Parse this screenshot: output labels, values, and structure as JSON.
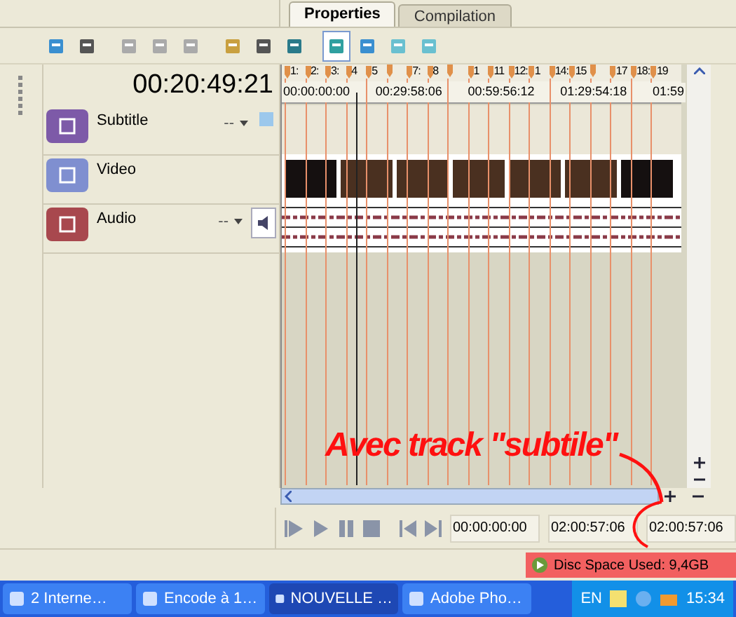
{
  "tabs": [
    {
      "label": "Properties",
      "selected": true
    },
    {
      "label": "Compilation",
      "selected": false
    }
  ],
  "toolbar": [
    {
      "selected": false
    },
    {
      "selected": false
    },
    {
      "selected": false
    },
    {
      "selected": false
    },
    {
      "selected": false
    },
    {
      "selected": false
    },
    {
      "selected": false
    },
    {
      "selected": false
    },
    {
      "selected": true
    },
    {
      "selected": false
    },
    {
      "selected": false
    },
    {
      "selected": false
    }
  ],
  "timecode": "00:20:49:21",
  "tracks": [
    {
      "kind": "subtitle",
      "name": "Subtitle",
      "dropdown": "--"
    },
    {
      "kind": "video",
      "name": "Video"
    },
    {
      "kind": "audio",
      "name": "Audio",
      "dropdown": "--"
    }
  ],
  "chapters": [
    {
      "kind": "labeled",
      "label": "1:"
    },
    {
      "kind": "labeled",
      "label": "2:"
    },
    {
      "kind": "labeled",
      "label": "3:"
    },
    {
      "kind": "labeled",
      "label": "4"
    },
    {
      "kind": "labeled",
      "label": "5"
    },
    {
      "kind": "plain"
    },
    {
      "kind": "labeled",
      "label": "7:"
    },
    {
      "kind": "labeled",
      "label": "8"
    },
    {
      "kind": "plain"
    },
    {
      "kind": "labeled",
      "label": "1"
    },
    {
      "kind": "labeled",
      "label": "11"
    },
    {
      "kind": "labeled",
      "label": "12:"
    },
    {
      "kind": "labeled",
      "label": "1"
    },
    {
      "kind": "labeled",
      "label": "14:"
    },
    {
      "kind": "labeled",
      "label": "15"
    },
    {
      "kind": "plain"
    },
    {
      "kind": "labeled",
      "label": "17"
    },
    {
      "kind": "labeled",
      "label": "18:"
    },
    {
      "kind": "labeled",
      "label": "19"
    }
  ],
  "ruler": [
    "00:00:00:00",
    "00:29:58:06",
    "00:59:56:12",
    "01:29:54:18",
    "01:59"
  ],
  "transport": {
    "times": [
      "00:00:00:00",
      "02:00:57:06",
      "02:00:57:06"
    ]
  },
  "annotation": "Avec track \"subtile\"",
  "status": "Disc Space Used: 9,4GB",
  "taskbar": {
    "items": [
      {
        "label": "2 Interne…",
        "selected": false
      },
      {
        "label": "Encode à 1…",
        "selected": false
      },
      {
        "label": "NOUVELLE …",
        "selected": true
      },
      {
        "label": "Adobe Pho…",
        "selected": false
      }
    ],
    "language": "EN",
    "clock": "15:34"
  }
}
